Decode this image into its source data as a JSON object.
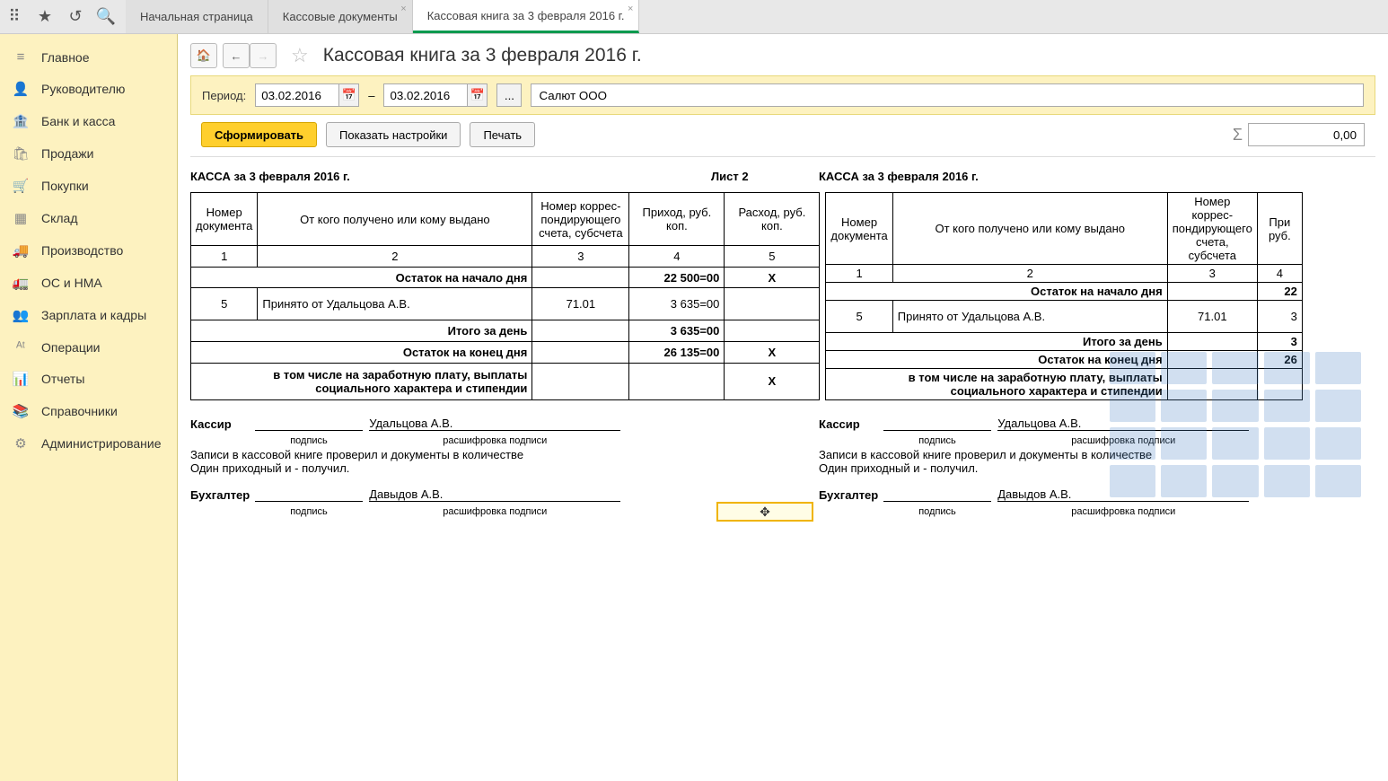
{
  "topIcons": [
    "apps",
    "star",
    "history",
    "search"
  ],
  "tabs": [
    {
      "label": "Начальная страница",
      "closable": false
    },
    {
      "label": "Кассовые документы",
      "closable": true
    },
    {
      "label": "Кассовая книга за 3 февраля 2016 г.",
      "closable": true,
      "active": true
    }
  ],
  "sidebar": [
    {
      "icon": "≡",
      "label": "Главное"
    },
    {
      "icon": "👤",
      "label": "Руководителю"
    },
    {
      "icon": "🏦",
      "label": "Банк и касса"
    },
    {
      "icon": "🛍",
      "label": "Продажи"
    },
    {
      "icon": "🛒",
      "label": "Покупки"
    },
    {
      "icon": "▦",
      "label": "Склад"
    },
    {
      "icon": "🚚",
      "label": "Производство"
    },
    {
      "icon": "🚛",
      "label": "ОС и НМА"
    },
    {
      "icon": "👥",
      "label": "Зарплата и кадры"
    },
    {
      "icon": "ᴬᵗ",
      "label": "Операции"
    },
    {
      "icon": "📊",
      "label": "Отчеты"
    },
    {
      "icon": "📚",
      "label": "Справочники"
    },
    {
      "icon": "⚙",
      "label": "Администрирование"
    }
  ],
  "pageTitle": "Кассовая книга за 3 февраля 2016 г.",
  "period": {
    "label": "Период:",
    "from": "03.02.2016",
    "to": "03.02.2016",
    "dash": "–"
  },
  "org": "Салют ООО",
  "actions": {
    "form": "Сформировать",
    "settings": "Показать настройки",
    "print": "Печать"
  },
  "sum": "0,00",
  "report": {
    "leftTitle": "КАССА за 3 февраля 2016 г.",
    "pageLabel": "Лист 2",
    "rightTitle": "КАССА за 3 февраля 2016 г.",
    "headers": {
      "h1": "Номер документа",
      "h2": "От кого получено или кому выдано",
      "h3": "Номер коррес-пондирующего счета, субсчета",
      "h4": "Приход, руб. коп.",
      "h5": "Расход, руб. коп.",
      "h4r": "При руб."
    },
    "cols": [
      "1",
      "2",
      "3",
      "4",
      "5"
    ],
    "rows": {
      "openBal": {
        "label": "Остаток на начало дня",
        "v4": "22 500=00",
        "v5": "Х",
        "v4r": "22"
      },
      "r1": {
        "num": "5",
        "desc": "Принято от Удальцова А.В.",
        "acc": "71.01",
        "in": "3 635=00",
        "out": "",
        "inr": "3"
      },
      "dayTot": {
        "label": "Итого за день",
        "v4": "3 635=00",
        "v4r": "3"
      },
      "closeBal": {
        "label": "Остаток на конец  дня",
        "v4": "26 135=00",
        "v5": "Х",
        "v4r": "26"
      },
      "incl": {
        "label": "в том числе на заработную плату, выплаты социального характера и стипендии",
        "v5": "Х"
      }
    },
    "sign": {
      "cashier": "Кассир",
      "cashierName": "Удальцова А.В.",
      "subSign": "подпись",
      "subName": "расшифровка подписи",
      "note1": "Записи в кассовой книге проверил и документы в количестве",
      "note2": "Один приходный и  -  получил.",
      "accountant": "Бухгалтер",
      "accName": "Давыдов А.В."
    }
  }
}
